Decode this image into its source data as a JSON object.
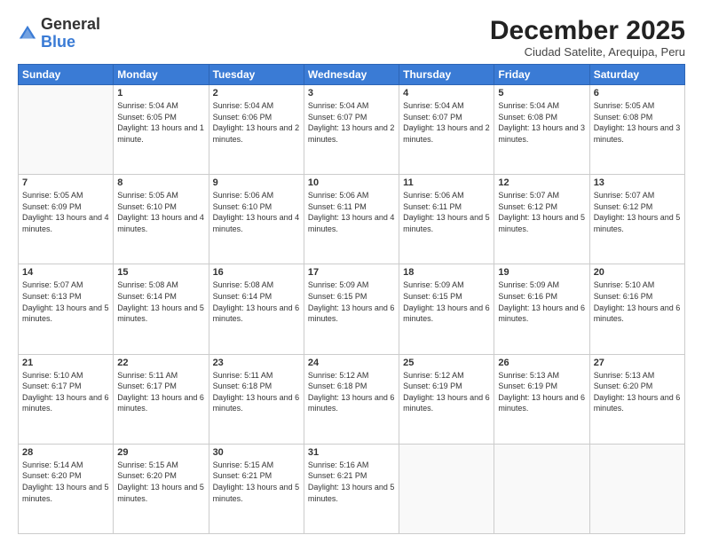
{
  "logo": {
    "general": "General",
    "blue": "Blue"
  },
  "header": {
    "month": "December 2025",
    "location": "Ciudad Satelite, Arequipa, Peru"
  },
  "weekdays": [
    "Sunday",
    "Monday",
    "Tuesday",
    "Wednesday",
    "Thursday",
    "Friday",
    "Saturday"
  ],
  "weeks": [
    [
      {
        "day": "",
        "sunrise": "",
        "sunset": "",
        "daylight": ""
      },
      {
        "day": "1",
        "sunrise": "Sunrise: 5:04 AM",
        "sunset": "Sunset: 6:05 PM",
        "daylight": "Daylight: 13 hours and 1 minute."
      },
      {
        "day": "2",
        "sunrise": "Sunrise: 5:04 AM",
        "sunset": "Sunset: 6:06 PM",
        "daylight": "Daylight: 13 hours and 2 minutes."
      },
      {
        "day": "3",
        "sunrise": "Sunrise: 5:04 AM",
        "sunset": "Sunset: 6:07 PM",
        "daylight": "Daylight: 13 hours and 2 minutes."
      },
      {
        "day": "4",
        "sunrise": "Sunrise: 5:04 AM",
        "sunset": "Sunset: 6:07 PM",
        "daylight": "Daylight: 13 hours and 2 minutes."
      },
      {
        "day": "5",
        "sunrise": "Sunrise: 5:04 AM",
        "sunset": "Sunset: 6:08 PM",
        "daylight": "Daylight: 13 hours and 3 minutes."
      },
      {
        "day": "6",
        "sunrise": "Sunrise: 5:05 AM",
        "sunset": "Sunset: 6:08 PM",
        "daylight": "Daylight: 13 hours and 3 minutes."
      }
    ],
    [
      {
        "day": "7",
        "sunrise": "Sunrise: 5:05 AM",
        "sunset": "Sunset: 6:09 PM",
        "daylight": "Daylight: 13 hours and 4 minutes."
      },
      {
        "day": "8",
        "sunrise": "Sunrise: 5:05 AM",
        "sunset": "Sunset: 6:10 PM",
        "daylight": "Daylight: 13 hours and 4 minutes."
      },
      {
        "day": "9",
        "sunrise": "Sunrise: 5:06 AM",
        "sunset": "Sunset: 6:10 PM",
        "daylight": "Daylight: 13 hours and 4 minutes."
      },
      {
        "day": "10",
        "sunrise": "Sunrise: 5:06 AM",
        "sunset": "Sunset: 6:11 PM",
        "daylight": "Daylight: 13 hours and 4 minutes."
      },
      {
        "day": "11",
        "sunrise": "Sunrise: 5:06 AM",
        "sunset": "Sunset: 6:11 PM",
        "daylight": "Daylight: 13 hours and 5 minutes."
      },
      {
        "day": "12",
        "sunrise": "Sunrise: 5:07 AM",
        "sunset": "Sunset: 6:12 PM",
        "daylight": "Daylight: 13 hours and 5 minutes."
      },
      {
        "day": "13",
        "sunrise": "Sunrise: 5:07 AM",
        "sunset": "Sunset: 6:12 PM",
        "daylight": "Daylight: 13 hours and 5 minutes."
      }
    ],
    [
      {
        "day": "14",
        "sunrise": "Sunrise: 5:07 AM",
        "sunset": "Sunset: 6:13 PM",
        "daylight": "Daylight: 13 hours and 5 minutes."
      },
      {
        "day": "15",
        "sunrise": "Sunrise: 5:08 AM",
        "sunset": "Sunset: 6:14 PM",
        "daylight": "Daylight: 13 hours and 5 minutes."
      },
      {
        "day": "16",
        "sunrise": "Sunrise: 5:08 AM",
        "sunset": "Sunset: 6:14 PM",
        "daylight": "Daylight: 13 hours and 6 minutes."
      },
      {
        "day": "17",
        "sunrise": "Sunrise: 5:09 AM",
        "sunset": "Sunset: 6:15 PM",
        "daylight": "Daylight: 13 hours and 6 minutes."
      },
      {
        "day": "18",
        "sunrise": "Sunrise: 5:09 AM",
        "sunset": "Sunset: 6:15 PM",
        "daylight": "Daylight: 13 hours and 6 minutes."
      },
      {
        "day": "19",
        "sunrise": "Sunrise: 5:09 AM",
        "sunset": "Sunset: 6:16 PM",
        "daylight": "Daylight: 13 hours and 6 minutes."
      },
      {
        "day": "20",
        "sunrise": "Sunrise: 5:10 AM",
        "sunset": "Sunset: 6:16 PM",
        "daylight": "Daylight: 13 hours and 6 minutes."
      }
    ],
    [
      {
        "day": "21",
        "sunrise": "Sunrise: 5:10 AM",
        "sunset": "Sunset: 6:17 PM",
        "daylight": "Daylight: 13 hours and 6 minutes."
      },
      {
        "day": "22",
        "sunrise": "Sunrise: 5:11 AM",
        "sunset": "Sunset: 6:17 PM",
        "daylight": "Daylight: 13 hours and 6 minutes."
      },
      {
        "day": "23",
        "sunrise": "Sunrise: 5:11 AM",
        "sunset": "Sunset: 6:18 PM",
        "daylight": "Daylight: 13 hours and 6 minutes."
      },
      {
        "day": "24",
        "sunrise": "Sunrise: 5:12 AM",
        "sunset": "Sunset: 6:18 PM",
        "daylight": "Daylight: 13 hours and 6 minutes."
      },
      {
        "day": "25",
        "sunrise": "Sunrise: 5:12 AM",
        "sunset": "Sunset: 6:19 PM",
        "daylight": "Daylight: 13 hours and 6 minutes."
      },
      {
        "day": "26",
        "sunrise": "Sunrise: 5:13 AM",
        "sunset": "Sunset: 6:19 PM",
        "daylight": "Daylight: 13 hours and 6 minutes."
      },
      {
        "day": "27",
        "sunrise": "Sunrise: 5:13 AM",
        "sunset": "Sunset: 6:20 PM",
        "daylight": "Daylight: 13 hours and 6 minutes."
      }
    ],
    [
      {
        "day": "28",
        "sunrise": "Sunrise: 5:14 AM",
        "sunset": "Sunset: 6:20 PM",
        "daylight": "Daylight: 13 hours and 5 minutes."
      },
      {
        "day": "29",
        "sunrise": "Sunrise: 5:15 AM",
        "sunset": "Sunset: 6:20 PM",
        "daylight": "Daylight: 13 hours and 5 minutes."
      },
      {
        "day": "30",
        "sunrise": "Sunrise: 5:15 AM",
        "sunset": "Sunset: 6:21 PM",
        "daylight": "Daylight: 13 hours and 5 minutes."
      },
      {
        "day": "31",
        "sunrise": "Sunrise: 5:16 AM",
        "sunset": "Sunset: 6:21 PM",
        "daylight": "Daylight: 13 hours and 5 minutes."
      },
      {
        "day": "",
        "sunrise": "",
        "sunset": "",
        "daylight": ""
      },
      {
        "day": "",
        "sunrise": "",
        "sunset": "",
        "daylight": ""
      },
      {
        "day": "",
        "sunrise": "",
        "sunset": "",
        "daylight": ""
      }
    ]
  ]
}
